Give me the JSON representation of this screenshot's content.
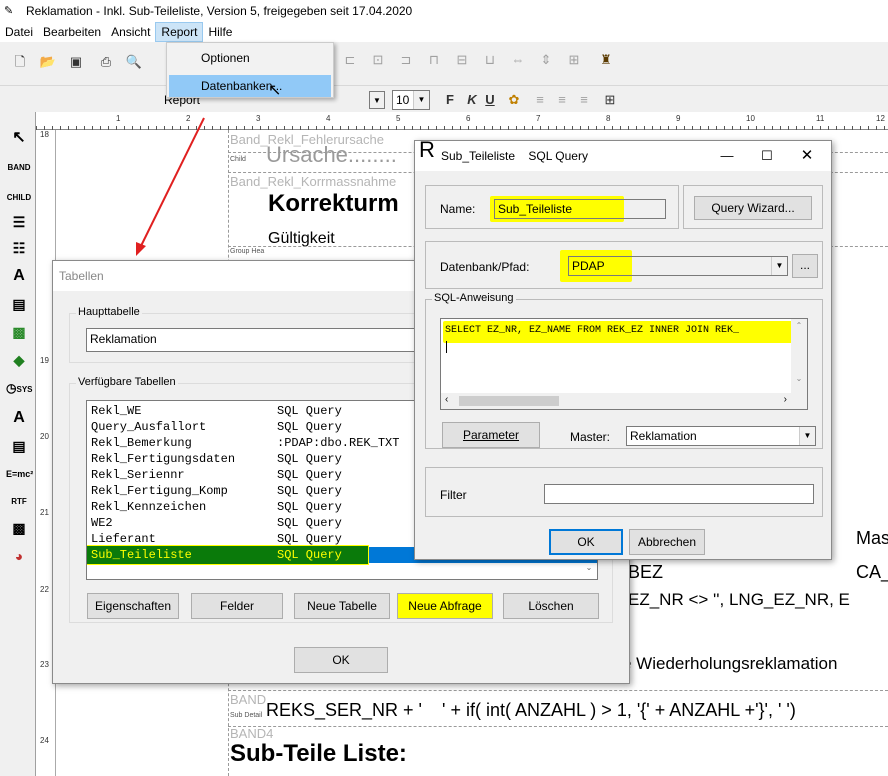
{
  "window": {
    "title": "Reklamation - Inkl. Sub-Teileliste, Version 5, freigegeben seit 17.04.2020"
  },
  "menubar": {
    "items": [
      "Datei",
      "Bearbeiten",
      "Ansicht",
      "Report",
      "Hilfe"
    ],
    "active": "Report"
  },
  "report_menu": {
    "items": [
      "Optionen",
      "Datenbanken..."
    ],
    "selected": "Datenbanken..."
  },
  "fontbar": {
    "font_name": "Report",
    "font_size": "10",
    "bold": "F",
    "italic": "K",
    "underline": "U"
  },
  "ruler": {
    "top_marks": [
      "1",
      "2",
      "3",
      "4",
      "5",
      "6",
      "7",
      "8",
      "9",
      "10",
      "11",
      "12",
      "13"
    ],
    "left_marks": [
      "18",
      "19",
      "20",
      "21",
      "22",
      "23",
      "24"
    ]
  },
  "leftbar": {
    "labels": [
      "BAND",
      "CHILD",
      "SYS",
      "RTF"
    ]
  },
  "canvas": {
    "band1_label": "Band_Rekl_Fehlerursache",
    "child_label": "Child",
    "ursache_text": "Ursache........",
    "band2_label": "Band_Rekl_Korrmassnahme",
    "korrektur_text": "Korrekturm",
    "gueltigkeit_text": "Gültigkeit",
    "group_header_label": "Group Hea",
    "mas_text": "Mas",
    "bez_text": "BEZ",
    "ca_text": "CA_",
    "ez_nr_text": "EZ_NR <> '', LNG_EZ_NR, E",
    "wiederholung_text": "e Wiederholungsreklamation",
    "band3_label": "BAND",
    "sub_detail_label": "Sub Detail",
    "reks_expression": "REKS_SER_NR + '    ' + if( int( ANZAHL ) > 1, '{' + ANZAHL +'}', ' ')",
    "band4_label": "BAND4",
    "sub_teile_title": "Sub-Teile Liste:"
  },
  "tabellen_dialog": {
    "title": "Tabellen",
    "haupttabelle_label": "Haupttabelle",
    "haupttabelle_value": "Reklamation",
    "verfuegbar_label": "Verfügbare Tabellen",
    "rows": [
      {
        "name": "Rekl_WE",
        "type": "SQL Query"
      },
      {
        "name": "Query_Ausfallort",
        "type": "SQL Query"
      },
      {
        "name": "Rekl_Bemerkung",
        "type": ":PDAP:dbo.REK_TXT"
      },
      {
        "name": "Rekl_Fertigungsdaten",
        "type": "SQL Query"
      },
      {
        "name": "Rekl_Seriennr",
        "type": "SQL Query"
      },
      {
        "name": "Rekl_Fertigung_Komp",
        "type": "SQL Query"
      },
      {
        "name": "Rekl_Kennzeichen",
        "type": "SQL Query"
      },
      {
        "name": "WE2",
        "type": "SQL Query"
      },
      {
        "name": "Lieferant",
        "type": "SQL Query"
      },
      {
        "name": "Sub_Teileliste",
        "type": "SQL Query"
      }
    ],
    "selected_row": "Sub_Teileliste",
    "buttons": {
      "eigenschaften": "Eigenschaften",
      "felder": "Felder",
      "neue_tabelle": "Neue Tabelle",
      "neue_abfrage": "Neue Abfrage",
      "loeschen": "Löschen",
      "ok": "OK"
    }
  },
  "sql_dialog": {
    "title": "Sub_Teileliste    SQL Query",
    "name_label": "Name:",
    "name_value": "Sub_Teileliste",
    "query_wizard": "Query Wizard...",
    "datenbank_label": "Datenbank/Pfad:",
    "datenbank_value": "PDAP",
    "browse": "...",
    "sql_label": "SQL-Anweisung",
    "sql_text": "SELECT EZ_NR, EZ_NAME FROM REK_EZ INNER JOIN REK_",
    "parameter": "Parameter",
    "master_label": "Master:",
    "master_value": "Reklamation",
    "filter_label": "Filter",
    "filter_value": "",
    "ok": "OK",
    "abbrechen": "Abbrechen"
  },
  "colors": {
    "highlight": "#ffff00",
    "selection_green": "#008000",
    "selection_blue": "#0078d7",
    "arrow": "#e02020"
  }
}
